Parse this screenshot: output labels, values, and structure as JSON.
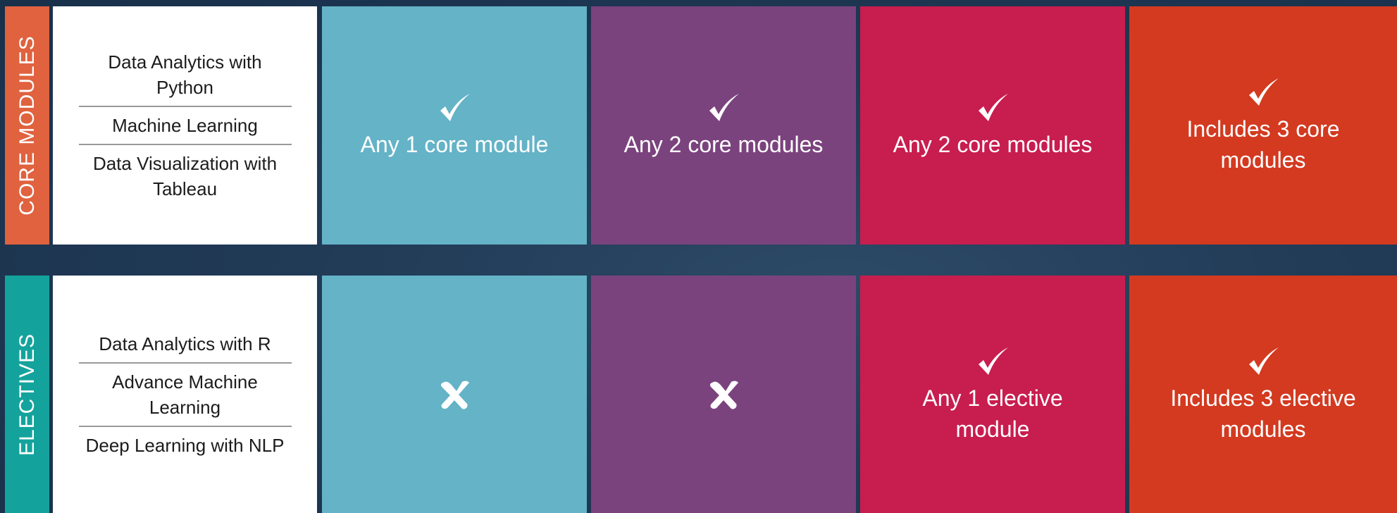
{
  "colors": {
    "background": "#1f3a56",
    "core_tab": "#e0623f",
    "electives_tab": "#14a39c",
    "plan_1": "#64b3c7",
    "plan_2": "#7b437e",
    "plan_3": "#c81d4f",
    "plan_4": "#d33a20"
  },
  "core": {
    "side_label": "CORE MODULES",
    "modules": [
      "Data Analytics with Python",
      "Machine Learning",
      "Data Visualization with Tableau"
    ],
    "cells": [
      {
        "icon": "check-icon",
        "text": "Any 1 core module"
      },
      {
        "icon": "check-icon",
        "text": "Any 2 core modules"
      },
      {
        "icon": "check-icon",
        "text": "Any 2 core modules"
      },
      {
        "icon": "check-icon",
        "text": "Includes 3 core modules"
      }
    ]
  },
  "electives": {
    "side_label": "ELECTIVES",
    "modules": [
      "Data Analytics with R",
      "Advance Machine Learning",
      "Deep Learning with NLP"
    ],
    "cells": [
      {
        "icon": "cross-icon",
        "text": ""
      },
      {
        "icon": "cross-icon",
        "text": ""
      },
      {
        "icon": "check-icon",
        "text": "Any 1 elective module"
      },
      {
        "icon": "check-icon",
        "text": "Includes 3 elective modules"
      }
    ]
  }
}
